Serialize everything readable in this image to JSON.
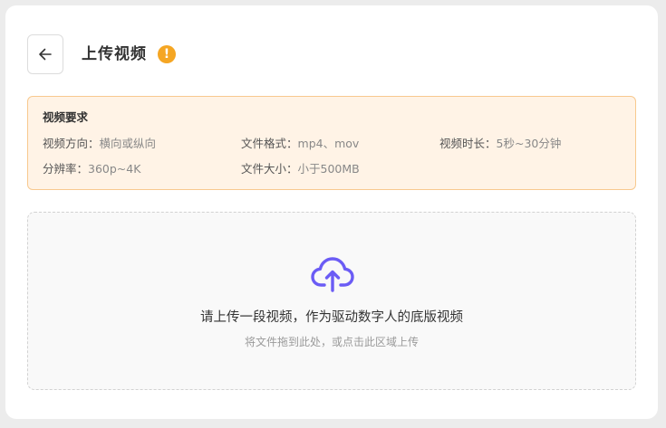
{
  "header": {
    "title": "上传视频",
    "warning_glyph": "!",
    "back_icon": "arrow-left-icon"
  },
  "requirements": {
    "title": "视频要求",
    "items": [
      {
        "label": "视频方向：",
        "value": "横向或纵向"
      },
      {
        "label": "文件格式：",
        "value": "mp4、mov"
      },
      {
        "label": "视频时长：",
        "value": "5秒~30分钟"
      },
      {
        "label": "分辨率：",
        "value": "360p~4K"
      },
      {
        "label": "文件大小：",
        "value": "小于500MB"
      }
    ]
  },
  "upload": {
    "icon": "cloud-upload-icon",
    "main_text": "请上传一段视频，作为驱动数字人的底版视频",
    "sub_text": "将文件拖到此处，或点击此区域上传"
  },
  "colors": {
    "accent": "#6b5cf5",
    "warning": "#f5a623",
    "notice_bg": "#fff3e6",
    "notice_border": "#f8c98f"
  }
}
